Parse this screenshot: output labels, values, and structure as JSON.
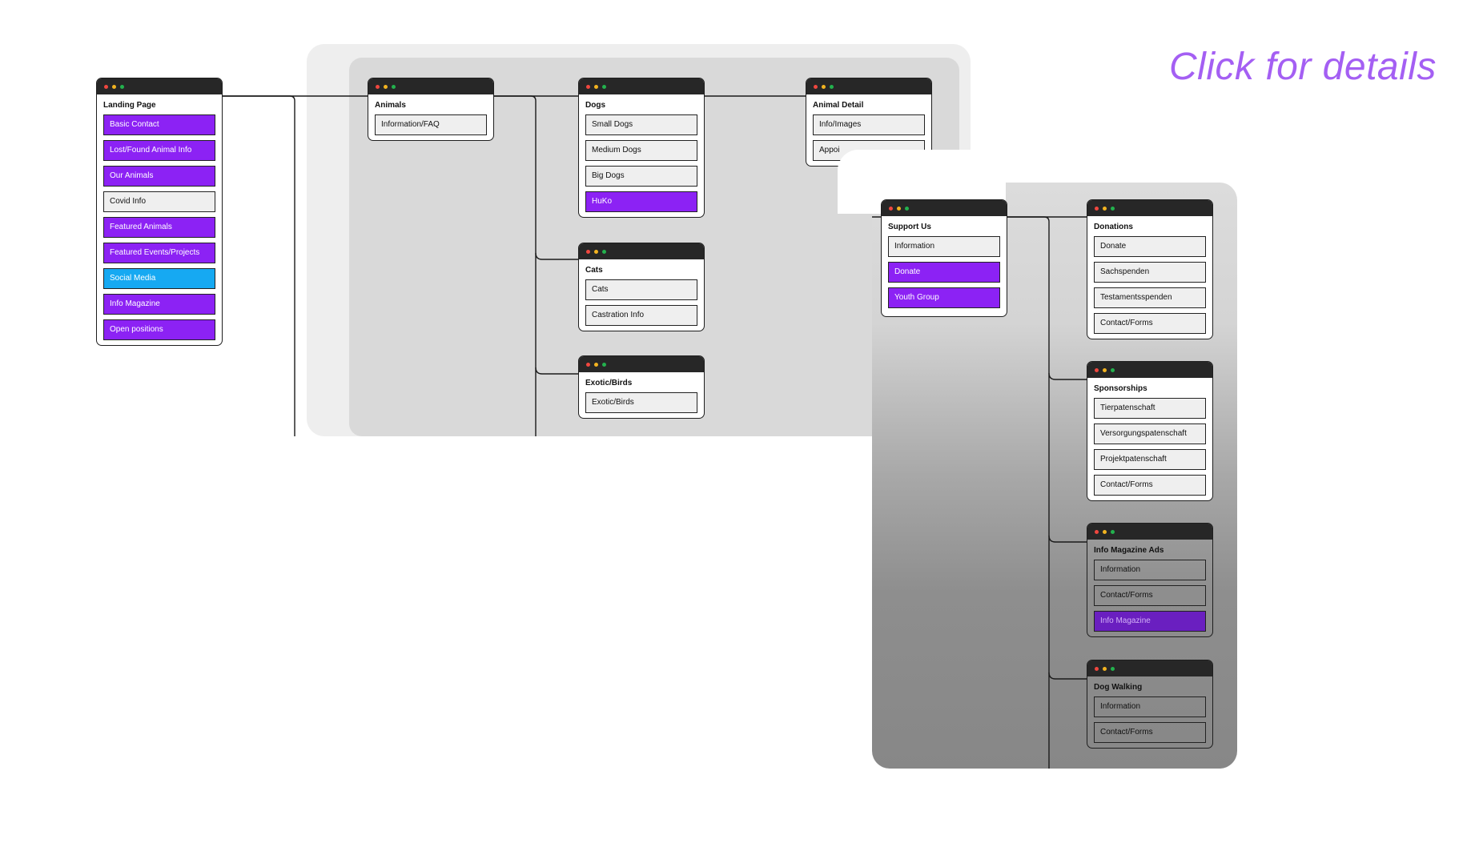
{
  "hint": "Click for details",
  "colors": {
    "accent_purple": "#8c22f4",
    "accent_blue": "#16a9f2",
    "titlebar": "#272727",
    "hint": "#a45ff3"
  },
  "cards": {
    "landing": {
      "title": "Landing Page",
      "items": [
        {
          "label": "Basic Contact",
          "style": "purple"
        },
        {
          "label": "Lost/Found Animal Info",
          "style": "purple"
        },
        {
          "label": "Our Animals",
          "style": "purple"
        },
        {
          "label": "Covid Info",
          "style": "plain"
        },
        {
          "label": "Featured Animals",
          "style": "purple"
        },
        {
          "label": "Featured Events/Projects",
          "style": "purple"
        },
        {
          "label": "Social Media",
          "style": "blue"
        },
        {
          "label": "Info Magazine",
          "style": "purple"
        },
        {
          "label": "Open positions",
          "style": "purple"
        }
      ]
    },
    "animals": {
      "title": "Animals",
      "items": [
        {
          "label": "Information/FAQ",
          "style": "plain"
        }
      ]
    },
    "dogs": {
      "title": "Dogs",
      "items": [
        {
          "label": "Small Dogs",
          "style": "plain"
        },
        {
          "label": "Medium Dogs",
          "style": "plain"
        },
        {
          "label": "Big Dogs",
          "style": "plain"
        },
        {
          "label": "HuKo",
          "style": "purple"
        }
      ]
    },
    "cats": {
      "title": "Cats",
      "items": [
        {
          "label": "Cats",
          "style": "plain"
        },
        {
          "label": "Castration Info",
          "style": "plain"
        }
      ]
    },
    "exotic": {
      "title": "Exotic/Birds",
      "items": [
        {
          "label": "Exotic/Birds",
          "style": "plain"
        }
      ]
    },
    "animal_detail": {
      "title": "Animal Detail",
      "items": [
        {
          "label": "Info/Images",
          "style": "plain"
        },
        {
          "label": "Appoi",
          "style": "plain"
        }
      ]
    },
    "support": {
      "title": "Support Us",
      "items": [
        {
          "label": "Information",
          "style": "plain"
        },
        {
          "label": "Donate",
          "style": "purple"
        },
        {
          "label": "Youth Group",
          "style": "purple"
        }
      ]
    },
    "donations": {
      "title": "Donations",
      "items": [
        {
          "label": "Donate",
          "style": "plain"
        },
        {
          "label": "Sachspenden",
          "style": "plain"
        },
        {
          "label": "Testamentsspenden",
          "style": "plain"
        },
        {
          "label": "Contact/Forms",
          "style": "plain"
        }
      ]
    },
    "sponsorships": {
      "title": "Sponsorships",
      "items": [
        {
          "label": "Tierpatenschaft",
          "style": "plain"
        },
        {
          "label": "Versorgungspatenschaft",
          "style": "plain"
        },
        {
          "label": "Projektpatenschaft",
          "style": "plain"
        },
        {
          "label": "Contact/Forms",
          "style": "plain"
        }
      ]
    },
    "magazine_ads": {
      "title": "Info Magazine Ads",
      "items": [
        {
          "label": "Information",
          "style": "plain"
        },
        {
          "label": "Contact/Forms",
          "style": "plain"
        },
        {
          "label": "Info Magazine",
          "style": "purple"
        }
      ]
    },
    "dog_walking": {
      "title": "Dog Walking",
      "items": [
        {
          "label": "Information",
          "style": "plain"
        },
        {
          "label": "Contact/Forms",
          "style": "plain"
        }
      ]
    }
  }
}
